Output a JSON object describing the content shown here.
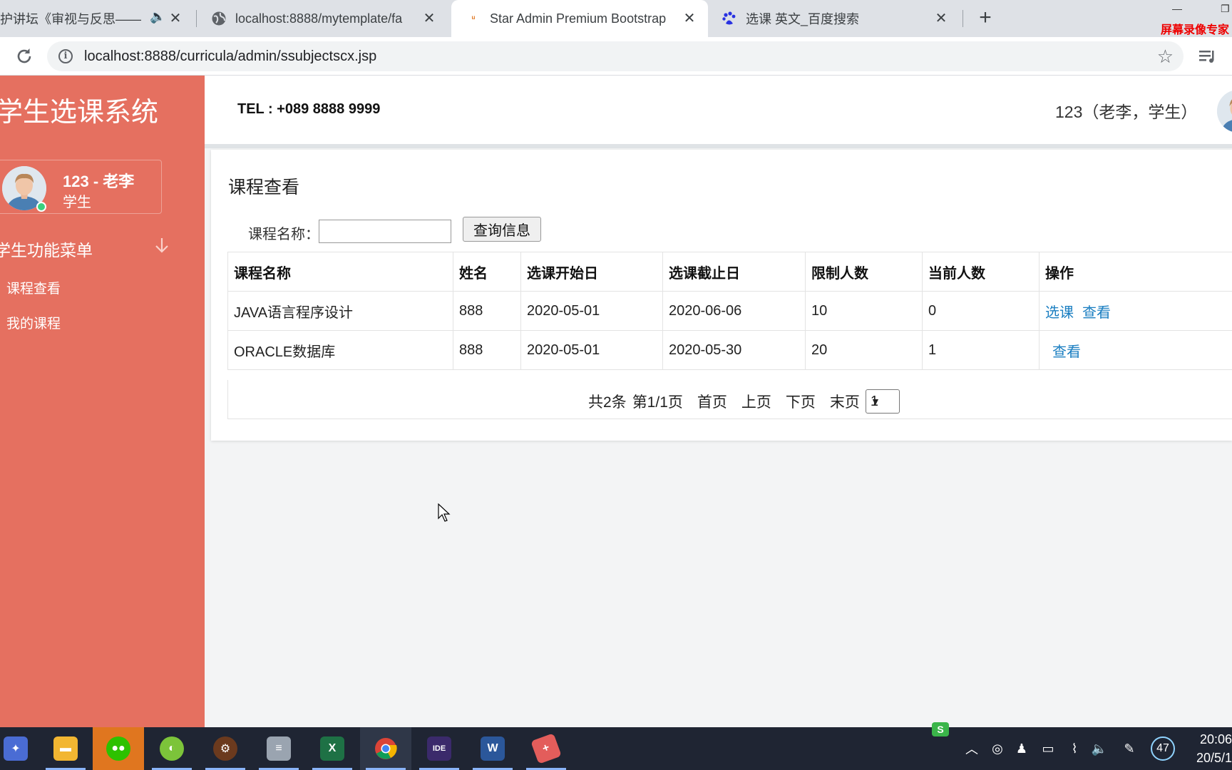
{
  "browser": {
    "tabs": [
      {
        "title": "护讲坛《审视与反思——",
        "active": false
      },
      {
        "title": "localhost:8888/mytemplate/fa",
        "active": false
      },
      {
        "title": "Star Admin Premium Bootstrap",
        "active": true
      },
      {
        "title": "选课 英文_百度搜索",
        "active": false
      }
    ],
    "url": "localhost:8888/curricula/admin/ssubjectscx.jsp",
    "recorder_label": "屏幕录像专家"
  },
  "sidebar": {
    "brand": "学生选课系统",
    "profile": {
      "name": "123 - 老李",
      "role": "学生"
    },
    "menu_heading": "学生功能菜单",
    "items": [
      {
        "label": "课程查看"
      },
      {
        "label": "我的课程"
      }
    ]
  },
  "header": {
    "tel": "TEL : +089 8888 9999",
    "user": "123（老李，学生）"
  },
  "main": {
    "title": "课程查看",
    "search": {
      "label": "课程名称：",
      "value": "",
      "button": "查询信息"
    },
    "table": {
      "columns": [
        "课程名称",
        "姓名",
        "选课开始日",
        "选课截止日",
        "限制人数",
        "当前人数",
        "操作"
      ],
      "rows": [
        {
          "name": "JAVA语言程序设计",
          "teacher": "888",
          "start": "2020-05-01",
          "end": "2020-06-06",
          "limit": "10",
          "current": "0",
          "actions": [
            "选课",
            "查看"
          ]
        },
        {
          "name": "ORACLE数据库",
          "teacher": "888",
          "start": "2020-05-01",
          "end": "2020-05-30",
          "limit": "20",
          "current": "1",
          "actions": [
            "查看"
          ]
        }
      ]
    },
    "pager": {
      "total": "共2条",
      "page": "第1/1页",
      "first": "首页",
      "prev": "上页",
      "next": "下页",
      "last": "末页",
      "select": "1"
    }
  },
  "taskbar": {
    "tray_badge": "47",
    "time": "20:06",
    "date": "20/5/1"
  },
  "colors": {
    "sidebar": "#e57060",
    "link": "#1a7ec1",
    "taskbar": "#1f2533",
    "active_app": "#e0761f"
  }
}
